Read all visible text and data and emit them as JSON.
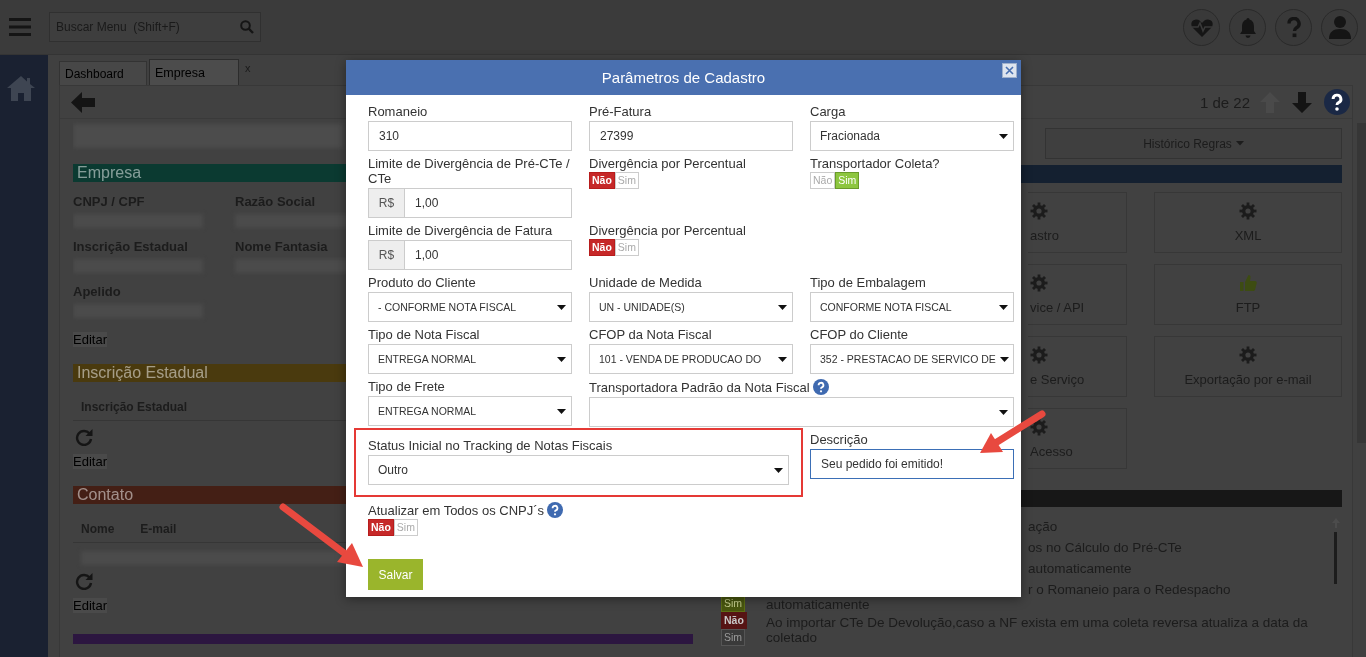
{
  "topbar": {
    "search": {
      "placeholder": "Buscar Menu  (Shift+F)"
    }
  },
  "tabs": [
    {
      "label": "Dashboard",
      "selected": false
    },
    {
      "label": "Empresa",
      "selected": true,
      "close": "x"
    }
  ],
  "toolbar": {
    "pager": "1 de 22",
    "previous_disabled": true,
    "next_disabled": false
  },
  "company": {
    "sections": [
      {
        "kind": "fields",
        "title": "Empresa",
        "color": "#0b3a31",
        "fields": [
          "CNPJ / CPF",
          "Razão Social",
          "Inscrição Estadual",
          "Nome Fantasia",
          "Apelido"
        ],
        "action": "Editar"
      },
      {
        "kind": "table",
        "title": "Inscrição Estadual",
        "color": "#4a3a0e",
        "columns": [
          "Inscrição Estadual"
        ],
        "redacted_rows": false,
        "action": "Editar"
      },
      {
        "kind": "table",
        "title": "Contato",
        "color": "#441f15",
        "columns": [
          "Nome",
          "E-mail"
        ],
        "redacted_rows": true,
        "action": "Editar"
      },
      {
        "kind": "bar",
        "color": "#2c1640"
      }
    ]
  },
  "rules": {
    "history_button": "Histórico Regras",
    "tiles": [
      {
        "label": "astro",
        "kind": "gear",
        "clipped": true
      },
      {
        "label": "XML",
        "kind": "gear",
        "clipped": false
      },
      {
        "label": "vice / API",
        "kind": "gear",
        "clipped": true
      },
      {
        "label": "FTP",
        "kind": "thumbs-up",
        "clipped": false
      },
      {
        "label": "e Serviço",
        "kind": "gear",
        "clipped": true
      },
      {
        "label": "Exportação por e-mail",
        "kind": "gear",
        "clipped": false
      },
      {
        "label": "Acesso",
        "kind": "gear",
        "clipped": true
      }
    ],
    "items": [
      {
        "text": "ação",
        "clipped": true
      },
      {
        "text": "os no Cálculo do Pré-CTe",
        "clipped": true
      },
      {
        "text": "automaticamente",
        "clipped": true
      },
      {
        "text": "r o Romaneio para o Redespacho automaticamente",
        "clipped": true,
        "options": [
          {
            "label": "Sim",
            "selected": true
          }
        ]
      },
      {
        "text": "Ao importar CTe De Devolução,caso a NF exista em uma coleta reversa atualiza a data da coletado",
        "clipped": false,
        "options": [
          {
            "label": "Não",
            "selected": true
          },
          {
            "label": "Sim",
            "selected": false
          }
        ]
      }
    ]
  },
  "modal": {
    "title": "Parâmetros de Cadastro",
    "rows": [
      [
        {
          "kind": "text",
          "label": "Romaneio",
          "value": "310"
        },
        {
          "kind": "text",
          "label": "Pré-Fatura",
          "value": "27399"
        },
        {
          "kind": "select",
          "label": "Carga",
          "value": "Fracionada"
        }
      ],
      [
        {
          "kind": "money",
          "label": "Limite de Divergência de Pré-CTe / CTe",
          "prefix": "R$",
          "value": "1,00"
        },
        {
          "kind": "toggle",
          "label": "Divergência por Percentual",
          "options": [
            {
              "label": "Não",
              "selected": true
            },
            {
              "label": "Sim",
              "selected": false
            }
          ]
        },
        {
          "kind": "toggle",
          "label": "Transportador Coleta?",
          "options": [
            {
              "label": "Não",
              "selected": false
            },
            {
              "label": "Sim",
              "selected": true
            }
          ]
        }
      ],
      [
        {
          "kind": "money",
          "label": "Limite de Divergência de Fatura",
          "prefix": "R$",
          "value": "1,00"
        },
        {
          "kind": "toggle",
          "label": "Divergência por Percentual",
          "options": [
            {
              "label": "Não",
              "selected": true
            },
            {
              "label": "Sim",
              "selected": false
            }
          ]
        }
      ],
      [
        {
          "kind": "select",
          "label": "Produto do Cliente",
          "value": "- CONFORME NOTA FISCAL"
        },
        {
          "kind": "select",
          "label": "Unidade de Medida",
          "value": "UN - UNIDADE(S)"
        },
        {
          "kind": "select",
          "label": "Tipo de Embalagem",
          "value": "CONFORME NOTA FISCAL"
        }
      ],
      [
        {
          "kind": "select",
          "label": "Tipo de Nota Fiscal",
          "value": "ENTREGA NORMAL"
        },
        {
          "kind": "select",
          "label": "CFOP da Nota Fiscal",
          "value": "101 - VENDA DE PRODUCAO DO"
        },
        {
          "kind": "select",
          "label": "CFOP do Cliente",
          "value": "352 - PRESTACAO DE SERVICO DE"
        }
      ],
      [
        {
          "kind": "select",
          "label": "Tipo de Frete",
          "value": "ENTREGA NORMAL"
        },
        {
          "kind": "select",
          "label": "Transportadora Padrão da Nota Fiscal",
          "help": true,
          "colspan": 2
        }
      ],
      [
        {
          "kind": "select",
          "label": "Status Inicial no Tracking de Notas Fiscais",
          "value": "Outro",
          "colspan": 2,
          "highlighted": true
        },
        {
          "kind": "text",
          "label": "Descrição",
          "value": "Seu pedido foi emitido!",
          "focused": true
        }
      ],
      [
        {
          "kind": "toggle",
          "label": "Atualizar em Todos os CNPJ´s",
          "help": true,
          "options": [
            {
              "label": "Não",
              "selected": true
            },
            {
              "label": "Sim",
              "selected": false
            }
          ]
        }
      ]
    ],
    "save_button": "Salvar"
  }
}
